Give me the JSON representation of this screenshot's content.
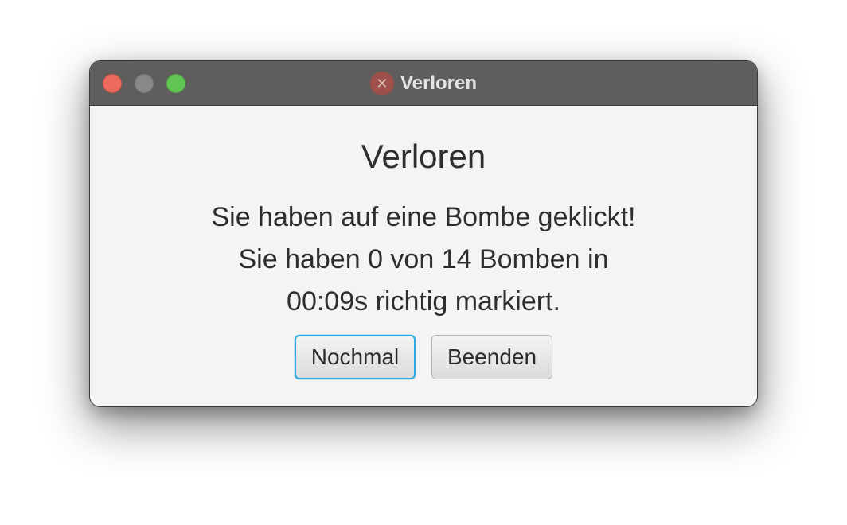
{
  "window": {
    "title": "Verloren",
    "title_icon": "close-circle-icon",
    "traffic_lights": {
      "close_color": "#ed6a5e",
      "minimize_color": "#8a8886",
      "maximize_color": "#61c554"
    }
  },
  "dialog": {
    "heading": "Verloren",
    "message_lines": [
      "Sie haben auf eine Bombe geklickt!",
      "Sie haben 0 von 14 Bomben in",
      "00:09s richtig markiert."
    ],
    "buttons": {
      "retry_label": "Nochmal",
      "quit_label": "Beenden"
    },
    "focus_color": "#2ea8e0"
  }
}
